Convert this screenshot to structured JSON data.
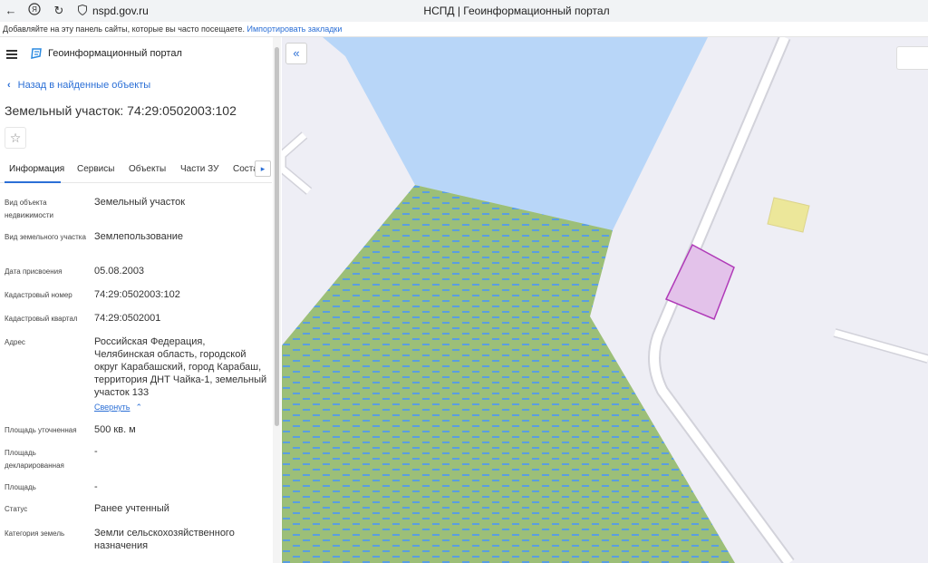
{
  "browser": {
    "url": "nspd.gov.ru",
    "title": "НСПД | Геоинформационный портал",
    "bookmarks_hint": "Добавляйте на эту панель сайты, которые вы часто посещаете.",
    "bookmarks_link": "Импортировать закладки"
  },
  "header": {
    "portal_name": "Геоинформационный портал"
  },
  "back_label": "Назад в найденные объекты",
  "object_title": "Земельный участок: 74:29:0502003:102",
  "tabs": [
    {
      "label": "Информация"
    },
    {
      "label": "Сервисы"
    },
    {
      "label": "Объекты"
    },
    {
      "label": "Части ЗУ"
    },
    {
      "label": "Соста"
    }
  ],
  "fields": [
    {
      "label": "Вид объекта недвижимости",
      "value": "Земельный участок"
    },
    {
      "label": "Вид земельного участка",
      "value": "Землепользование"
    },
    {
      "label": "Дата присвоения",
      "value": "05.08.2003"
    },
    {
      "label": "Кадастровый номер",
      "value": "74:29:0502003:102"
    },
    {
      "label": "Кадастровый квартал",
      "value": "74:29:0502001"
    },
    {
      "label": "Адрес",
      "value": "Российская Федерация, Челябинская область, городской округ Карабашский, город Карабаш, территория ДНТ Чайка-1, земельный участок 133"
    },
    {
      "label": "Площадь уточненная",
      "value": "500 кв. м"
    },
    {
      "label": "Площадь декларированная",
      "value": "-"
    },
    {
      "label": "Площадь",
      "value": "-"
    },
    {
      "label": "Статус",
      "value": "Ранее учтенный"
    },
    {
      "label": "Категория земель",
      "value": "Земли сельскохозяйственного назначения"
    }
  ],
  "collapse_label": "Свернуть",
  "colors": {
    "accent": "#2b6fd6",
    "water": "#b8d6f8",
    "wetland": "#9cbf78",
    "wetland_dash": "#5a9ee0",
    "parcel_fill": "#e3c2ea",
    "parcel_stroke": "#b03ab8",
    "building": "#ece79a"
  },
  "icons": {
    "back": "chevron-left-icon",
    "star": "star-icon",
    "menu": "hamburger-icon",
    "collapse_panel": "double-chevron-left-icon",
    "tab_next": "chevron-right-icon",
    "collapse": "chevron-up-icon"
  }
}
